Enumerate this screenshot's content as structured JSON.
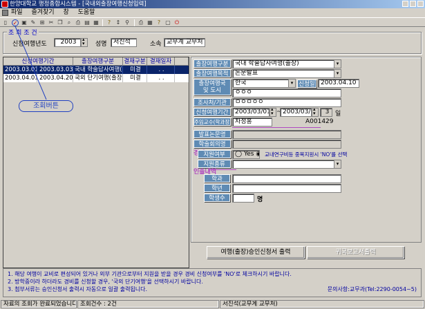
{
  "window": {
    "title": "한양대학교 행정종합시스템 - [국내외출장여행신청입력]"
  },
  "menu": [
    "파일",
    "즐겨찾기",
    "창",
    "도움말"
  ],
  "toolbar": {
    "icons": [
      "new-icon",
      "retrieve-icon",
      "save-icon",
      "delete-icon",
      "insert-icon",
      "cut-icon",
      "copy-icon",
      "search-icon",
      "print-icon",
      "preview-icon",
      "export-icon",
      "help-icon",
      "sort-icon",
      "filter-icon",
      "close-icon"
    ]
  },
  "filter": {
    "caption": "조 회 조 건",
    "year_label": "신청여행년도",
    "year_value": "2003",
    "name_label": "성명",
    "name_value": "서진석",
    "dept_label": "소속",
    "dept_value": "교무계 교무처"
  },
  "grid": {
    "columns": [
      "신청여행기간",
      "출장여행구분",
      "결재구분",
      "결재일자"
    ],
    "rows": [
      {
        "start": "2003.03.01",
        "end": "2003.03.03",
        "type": "국내 학술답사여행(출",
        "status": "미결",
        "date": ". ."
      },
      {
        "start": "2003.04.01",
        "end": "2003.04.20",
        "type": "국외 단기여행(출장)",
        "status": "미결",
        "date": ". ."
      }
    ]
  },
  "callout": {
    "label": "조회버튼"
  },
  "form": {
    "trip_type_label": "출장여행구분",
    "trip_type_value": "국내 학술답사여행(출장)",
    "trip_purpose_label": "출장여행목적",
    "trip_purpose_value": "논문발표",
    "country_label": "출장여행국\n및 도시",
    "country_value": "한국",
    "apply_date_label": "신청일",
    "apply_date_value": "2003.04.10",
    "city_value": "ㅇㅇㅇ",
    "institution_label": "조사처/기관",
    "institution_value": "ㅁㅇㅁㅇㅇ",
    "period_label": "신청여행기간",
    "period_start": "2003/03/01",
    "period_tilde": "~",
    "period_end": "2003/03/03",
    "period_days": "3",
    "period_unit": "일",
    "advisor_label": "주임교수(학과장,학부장)",
    "advisor_value": "차정홍",
    "advisor_code": "A001429",
    "paper_title_label": "발표논문명",
    "conference_label": "학술회의명",
    "expense_heading": "경비",
    "support_label": "지원여부",
    "support_yes": "Yes",
    "support_no": "No",
    "support_note": "교내연구비등 중복지원시 'NO'를 선택",
    "support_type_label": "지원종류",
    "escort_heading": "인솔내역",
    "dept_label": "학과",
    "grade_label": "학년",
    "students_label": "학생수",
    "students_unit": "명",
    "print_button": "여행(출장)승인신청서 출력",
    "report_button": "귀국보고서출력"
  },
  "notes": {
    "line1": "1. 해당 여행이 교비로 편성되어 있거나 외부 기관으로부터 지원을 받을 경우 경비 신청여부를 'NO'로 체크하시기 바랍니다.",
    "line2": "2. 방학중이라 하더라도 경비를 신청할 경우, '국외 단기여행'을 선택하시기 바랍니다.",
    "line3": "3. 첨부서류는 승인신청서 출력시 자동으로 일괄 출력됩니다.",
    "contact": "문의사항:교무과(Tel:2290-0054~5)"
  },
  "status": {
    "message": "자료의 조회가 완료되었습니다.",
    "count": "조회건수 : 2건",
    "user": "서진석(교무계 교무처)"
  },
  "colors": {
    "selected_row": "#0a246a",
    "label_bg": "#5f8bb4",
    "accent": "#b048c0"
  }
}
